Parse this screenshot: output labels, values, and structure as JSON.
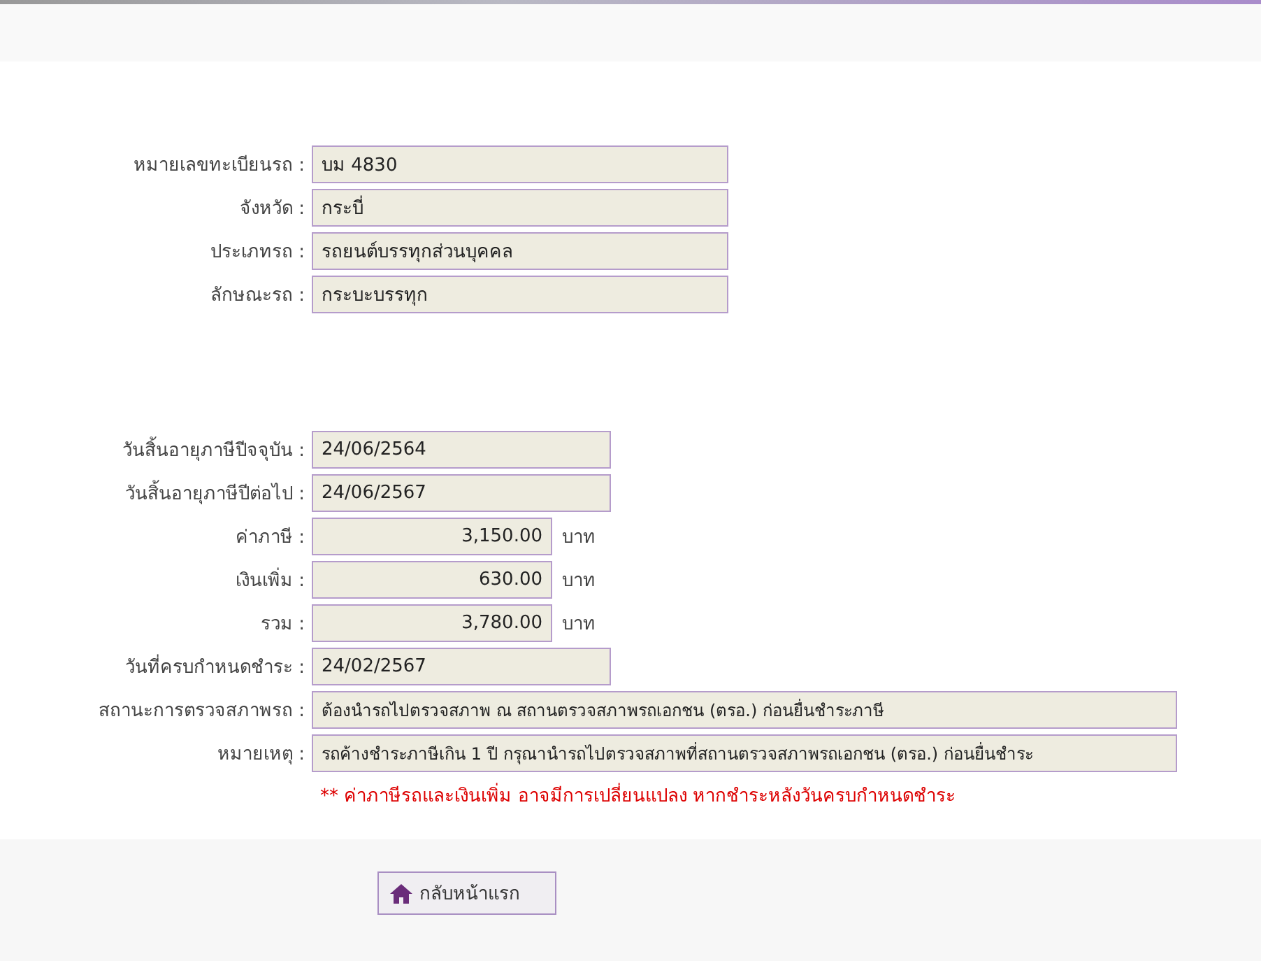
{
  "vehicle_fields": [
    {
      "kind": "wide",
      "label": "หมายเลขทะเบียนรถ :",
      "value": "บม 4830"
    },
    {
      "kind": "wide",
      "label": "จังหวัด :",
      "value": "กระบี่"
    },
    {
      "kind": "wide",
      "label": "ประเภทรถ :",
      "value": "รถยนต์บรรทุกส่วนบุคคล"
    },
    {
      "kind": "wide",
      "label": "ลักษณะรถ :",
      "value": "กระบะบรรทุก"
    }
  ],
  "tax_fields": [
    {
      "kind": "date",
      "label": "วันสิ้นอายุภาษีปีจจุบัน :",
      "value": "24/06/2564"
    },
    {
      "kind": "date",
      "label": "วันสิ้นอายุภาษีปีต่อไป :",
      "value": "24/06/2567"
    },
    {
      "kind": "money",
      "label": "ค่าภาษี :",
      "value": "3,150.00",
      "unit": "บาท"
    },
    {
      "kind": "money",
      "label": "เงินเพิ่ม :",
      "value": "630.00",
      "unit": "บาท"
    },
    {
      "kind": "money",
      "label": "รวม :",
      "value": "3,780.00",
      "unit": "บาท"
    },
    {
      "kind": "date",
      "label": "วันที่ครบกำหนดชำระ :",
      "value": "24/02/2567"
    },
    {
      "kind": "long",
      "label": "สถานะการตรวจสภาพรถ :",
      "value": "ต้องนำรถไปตรวจสภาพ ณ สถานตรวจสภาพรถเอกชน (ตรอ.) ก่อนยื่นชำระภาษี"
    },
    {
      "kind": "long",
      "label": "หมายเหตุ :",
      "value": "รถค้างชำระภาษีเกิน 1 ปี กรุณานำรถไปตรวจสภาพที่สถานตรวจสภาพรถเอกชน (ตรอ.) ก่อนยื่นชำระ"
    }
  ],
  "warning": "** ค่าภาษีรถและเงินเพิ่ม อาจมีการเปลี่ยนแปลง หากชำระหลังวันครบกำหนดชำระ",
  "home_button": {
    "label": "กลับหน้าแรก"
  }
}
